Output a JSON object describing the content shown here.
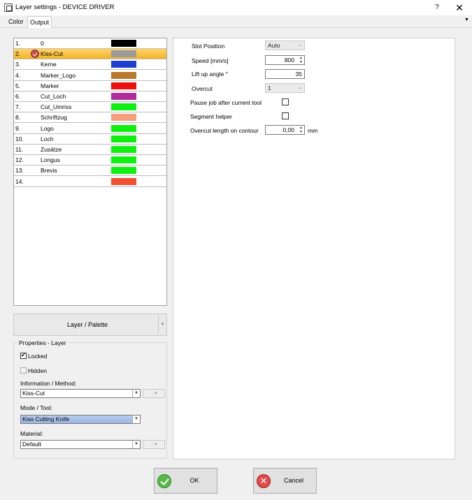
{
  "window": {
    "title": "Layer settings - DEVICE DRIVER",
    "help": "?",
    "close": "✕"
  },
  "tabs": [
    {
      "label": "Color"
    },
    {
      "label": "Output"
    }
  ],
  "tab_overflow": "▼",
  "layers": [
    {
      "num": "1.",
      "name": "0",
      "color": "#000000"
    },
    {
      "num": "2.",
      "name": "Kiss-Cut",
      "color": "#9a9a9a",
      "selected": true,
      "icon": "check-badge-icon"
    },
    {
      "num": "3.",
      "name": "Kerne",
      "color": "#2040d0"
    },
    {
      "num": "4.",
      "name": "Marker_Logo",
      "color": "#b87a2e"
    },
    {
      "num": "5.",
      "name": "Marker",
      "color": "#ee1010"
    },
    {
      "num": "6.",
      "name": "Cut_Loch",
      "color": "#b02c9a"
    },
    {
      "num": "7.",
      "name": "Cut_Umriss",
      "color": "#10f010"
    },
    {
      "num": "8.",
      "name": "Schriftzug",
      "color": "#f4a07c"
    },
    {
      "num": "9.",
      "name": "Logo",
      "color": "#10f010"
    },
    {
      "num": "10.",
      "name": "Loch",
      "color": "#10f010"
    },
    {
      "num": "11.",
      "name": "Zusätze",
      "color": "#10f010"
    },
    {
      "num": "12.",
      "name": "Longus",
      "color": "#10f010"
    },
    {
      "num": "13.",
      "name": "Brevis",
      "color": "#10f010"
    },
    {
      "num": "14.",
      "name": "",
      "color": "#f25030"
    }
  ],
  "layer_palette": {
    "label": "Layer / Palette",
    "arrow": "▾"
  },
  "properties": {
    "title": "Properties - Layer",
    "locked_label": "Locked",
    "locked": true,
    "hidden_label": "Hidden",
    "hidden": false,
    "info_label": "Information / Method:",
    "info_value": "Kiss-Cut",
    "mode_label": "Mode / Tool:",
    "mode_value": "Kiss Cutting Knife",
    "material_label": "Material:",
    "material_value": "Default",
    "mini_btn": "...▾"
  },
  "output": {
    "slot_position_label": "Slot Position",
    "slot_position_value": "Auto",
    "speed_label": "Speed [mm/s]",
    "speed_value": "800",
    "lift_angle_label": "Lift up angle °",
    "lift_angle_value": "35",
    "overcut_label": "Overcut",
    "overcut_value": "1",
    "pause_label": "Pause job after current tool",
    "segment_label": "Segment helper",
    "overcut_length_label": "Overcut length on contour",
    "overcut_length_value": "0,00",
    "overcut_length_unit": "mm"
  },
  "buttons": {
    "ok": "OK",
    "cancel": "Cancel",
    "cancel_glyph": "✕"
  },
  "glyphs": {
    "combo_arrow": "▼",
    "spin_up": "▲",
    "spin_down": "▼",
    "rcombo_arrow": "⌄"
  }
}
